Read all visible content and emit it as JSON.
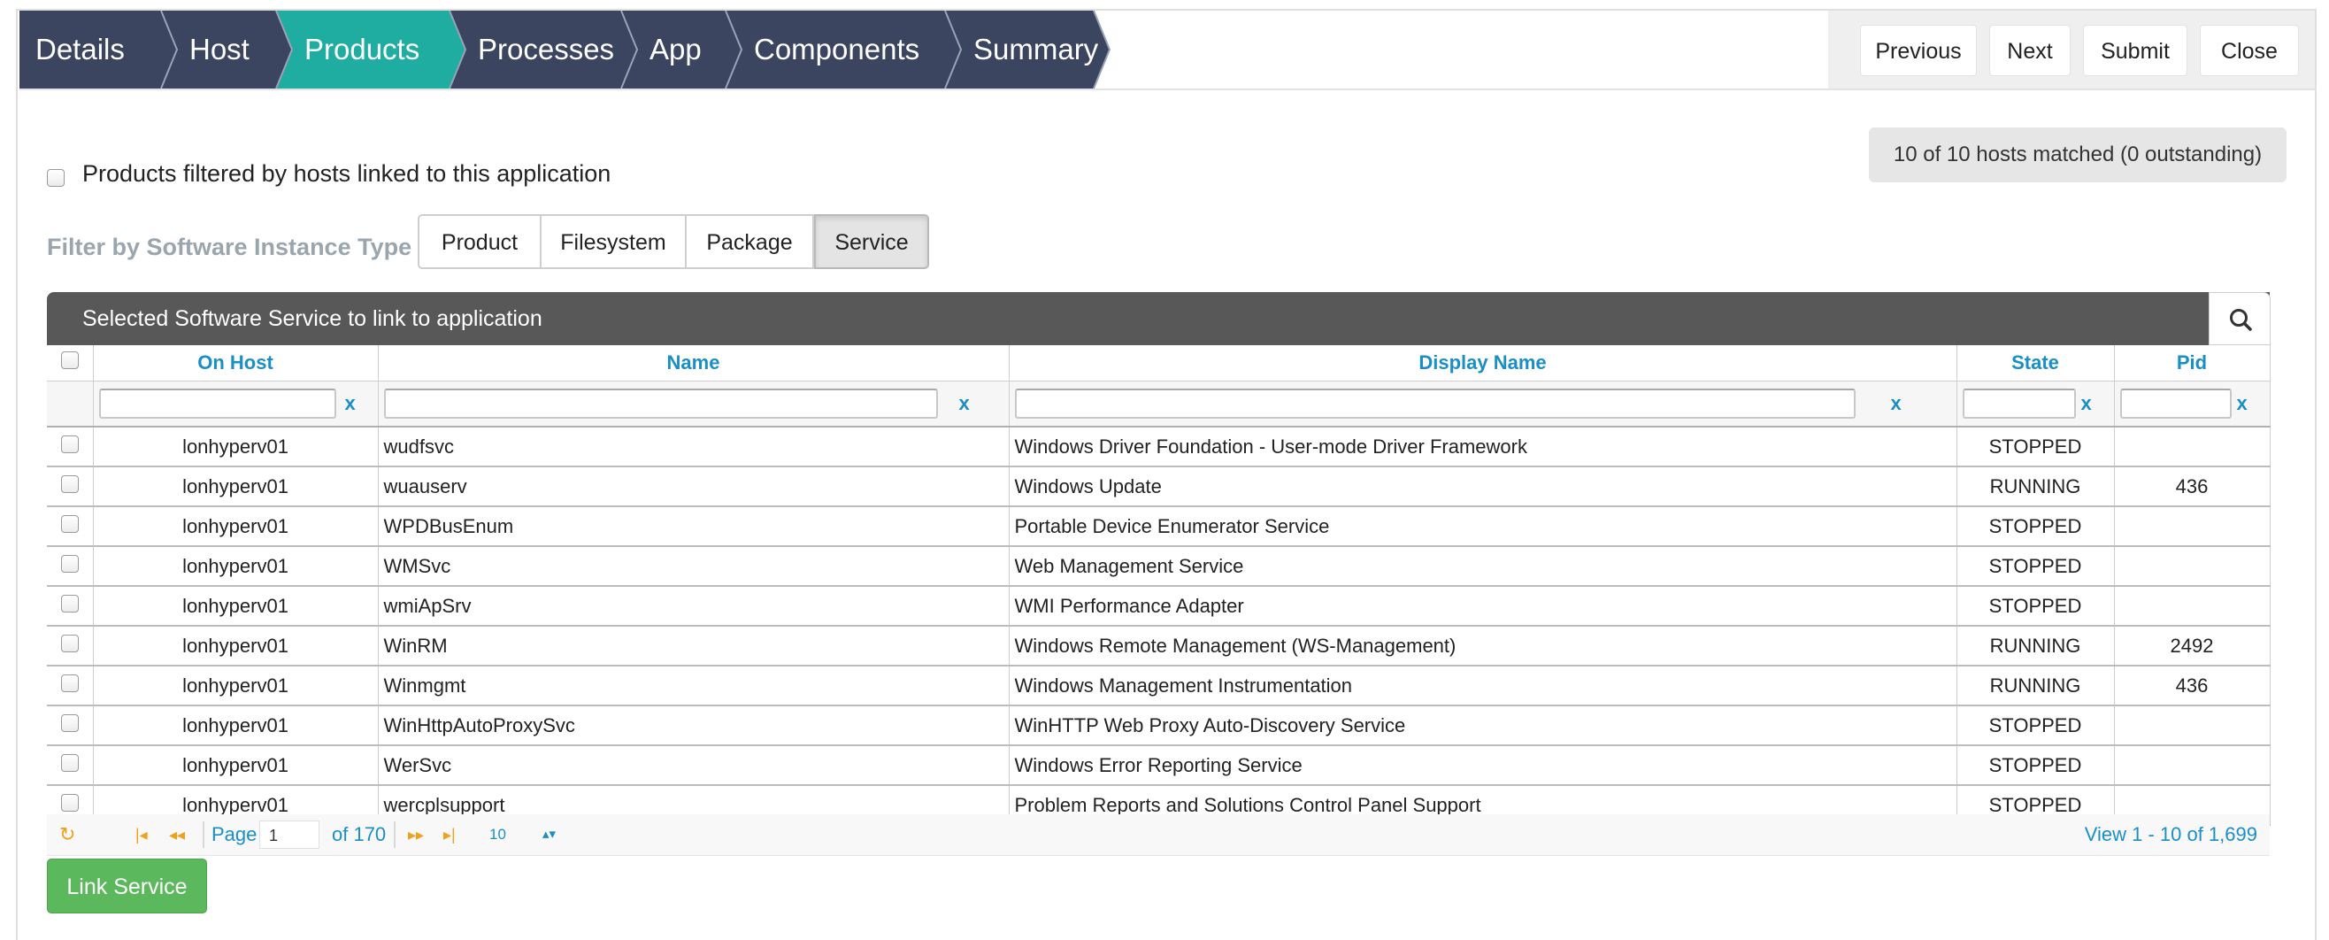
{
  "wizard": {
    "steps": [
      {
        "label": "Details",
        "active": false
      },
      {
        "label": "Host",
        "active": false
      },
      {
        "label": "Products",
        "active": true
      },
      {
        "label": "Processes",
        "active": false
      },
      {
        "label": "App",
        "active": false
      },
      {
        "label": "Components",
        "active": false
      },
      {
        "label": "Summary",
        "active": false
      }
    ],
    "colors": {
      "dark": "#3b4560",
      "active": "#1eada0",
      "separator": "#9aa3b5"
    }
  },
  "actions": {
    "previous": "Previous",
    "next": "Next",
    "submit": "Submit",
    "close": "Close"
  },
  "match_status": "10 of 10 hosts matched (0 outstanding)",
  "host_filter": {
    "label": "Products filtered by hosts linked to this application",
    "checked": false
  },
  "type_filter": {
    "label": "Filter by Software Instance Type",
    "options": [
      "Product",
      "Filesystem",
      "Package",
      "Service"
    ],
    "selected": "Service"
  },
  "grid": {
    "title": "Selected Software Service to link to application",
    "search_icon": "search-icon",
    "columns": [
      "On Host",
      "Name",
      "Display Name",
      "State",
      "Pid"
    ],
    "clear_label": "x",
    "rows": [
      {
        "host": "lonhyperv01",
        "name": "wudfsvc",
        "display": "Windows Driver Foundation - User-mode Driver Framework",
        "state": "STOPPED",
        "pid": ""
      },
      {
        "host": "lonhyperv01",
        "name": "wuauserv",
        "display": "Windows Update",
        "state": "RUNNING",
        "pid": "436"
      },
      {
        "host": "lonhyperv01",
        "name": "WPDBusEnum",
        "display": "Portable Device Enumerator Service",
        "state": "STOPPED",
        "pid": ""
      },
      {
        "host": "lonhyperv01",
        "name": "WMSvc",
        "display": "Web Management Service",
        "state": "STOPPED",
        "pid": ""
      },
      {
        "host": "lonhyperv01",
        "name": "wmiApSrv",
        "display": "WMI Performance Adapter",
        "state": "STOPPED",
        "pid": ""
      },
      {
        "host": "lonhyperv01",
        "name": "WinRM",
        "display": "Windows Remote Management (WS-Management)",
        "state": "RUNNING",
        "pid": "2492"
      },
      {
        "host": "lonhyperv01",
        "name": "Winmgmt",
        "display": "Windows Management Instrumentation",
        "state": "RUNNING",
        "pid": "436"
      },
      {
        "host": "lonhyperv01",
        "name": "WinHttpAutoProxySvc",
        "display": "WinHTTP Web Proxy Auto-Discovery Service",
        "state": "STOPPED",
        "pid": ""
      },
      {
        "host": "lonhyperv01",
        "name": "WerSvc",
        "display": "Windows Error Reporting Service",
        "state": "STOPPED",
        "pid": ""
      },
      {
        "host": "lonhyperv01",
        "name": "wercplsupport",
        "display": "Problem Reports and Solutions Control Panel Support",
        "state": "STOPPED",
        "pid": ""
      }
    ]
  },
  "pager": {
    "page_label": "Page",
    "page_value": "1",
    "of_label": "of 170",
    "rows_per_page": "10",
    "view_label": "View 1 - 10 of 1,699"
  },
  "link_button": "Link Service"
}
